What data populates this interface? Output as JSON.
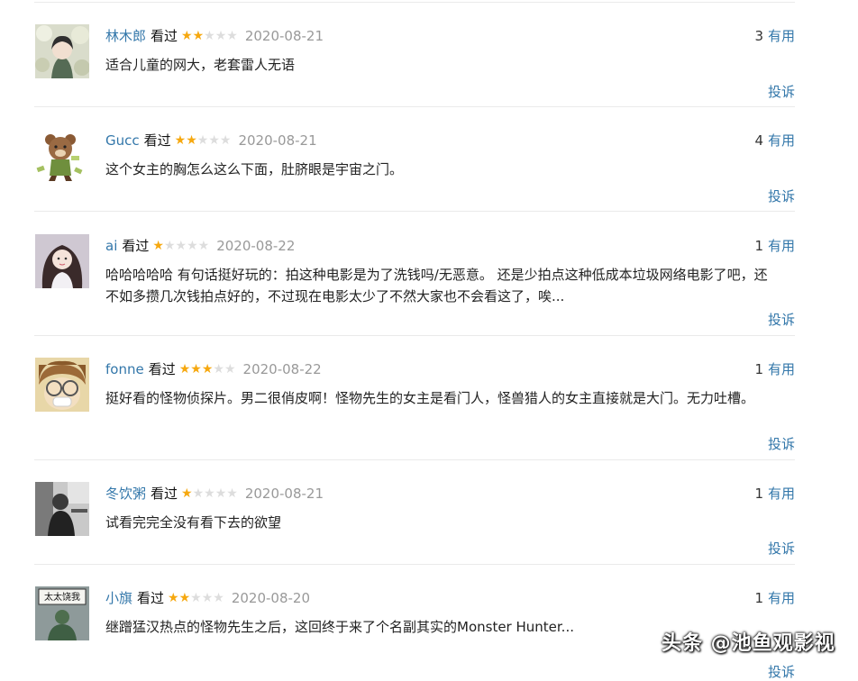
{
  "comments": [
    {
      "user": "林木郎",
      "status": "看过",
      "rating": 2,
      "date": "2020-08-21",
      "useful_count": "3",
      "useful_label": "有用",
      "text": "适合儿童的网大，老套雷人无语",
      "report_label": "投诉"
    },
    {
      "user": "Gucc",
      "status": "看过",
      "rating": 2,
      "date": "2020-08-21",
      "useful_count": "4",
      "useful_label": "有用",
      "text": "这个女主的胸怎么这么下面，肚脐眼是宇宙之门。",
      "report_label": "投诉"
    },
    {
      "user": "ai",
      "status": "看过",
      "rating": 1,
      "date": "2020-08-22",
      "useful_count": "1",
      "useful_label": "有用",
      "text": "哈哈哈哈哈 有句话挺好玩的：拍这种电影是为了洗钱吗/无恶意。 还是少拍点这种低成本垃圾网络电影了吧，还不如多攒几次钱拍点好的，不过现在电影太少了不然大家也不会看这了，唉...",
      "report_label": "投诉"
    },
    {
      "user": "fonne",
      "status": "看过",
      "rating": 3,
      "date": "2020-08-22",
      "useful_count": "1",
      "useful_label": "有用",
      "text": "挺好看的怪物侦探片。男二很俏皮啊！怪物先生的女主是看门人，怪兽猎人的女主直接就是大门。无力吐槽。",
      "report_label": "投诉"
    },
    {
      "user": "冬饮粥",
      "status": "看过",
      "rating": 1,
      "date": "2020-08-21",
      "useful_count": "1",
      "useful_label": "有用",
      "text": "试看完完全没有看下去的欲望",
      "report_label": "投诉"
    },
    {
      "user": "小旗",
      "status": "看过",
      "rating": 2,
      "date": "2020-08-20",
      "useful_count": "1",
      "useful_label": "有用",
      "text": "继蹭猛汉热点的怪物先生之后，这回终于来了个名副其实的Monster Hunter...",
      "report_label": "投诉",
      "avatar_text": "太太饶我"
    }
  ],
  "watermark": "头条 @池鱼观影视",
  "colors": {
    "link": "#3377aa",
    "star_on": "#f6a80f",
    "star_off": "#dddddd",
    "date": "#999999"
  }
}
